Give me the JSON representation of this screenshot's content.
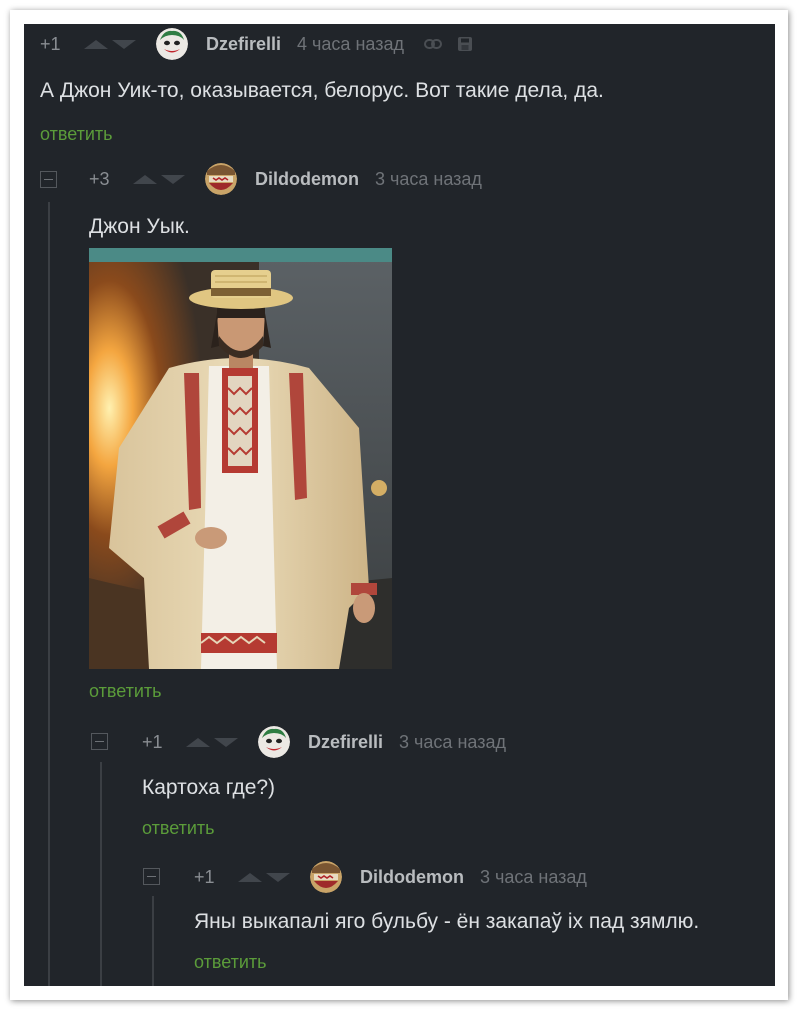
{
  "comments": [
    {
      "score": "+1",
      "author": "Dzefirelli",
      "time": "4 часа назад",
      "avatar": "joker-avatar",
      "text": "А Джон Уик-то, оказывается, белорус. Вот такие дела, да.",
      "reply": "ответить",
      "icons": [
        "link-icon",
        "save-icon"
      ]
    },
    {
      "score": "+3",
      "author": "Dildodemon",
      "time": "3 часа назад",
      "avatar": "mask-avatar",
      "text": "Джон Уык.",
      "reply": "ответить",
      "image": "man-in-belarusian-embroidered-folk-costume-with-straw-hat"
    },
    {
      "score": "+1",
      "author": "Dzefirelli",
      "time": "3 часа назад",
      "avatar": "joker-avatar",
      "text": "Картоха где?)",
      "reply": "ответить"
    },
    {
      "score": "+1",
      "author": "Dildodemon",
      "time": "3 часа назад",
      "avatar": "mask-avatar",
      "text": "Яны выкапалі яго бульбу - ён закапаў іх пад зямлю.",
      "reply": "ответить"
    }
  ],
  "colors": {
    "background": "#21252a",
    "reply_link": "#5b9c3a",
    "author": "#b9bcbf",
    "meta": "#6f7378",
    "text": "#dde0e3"
  }
}
